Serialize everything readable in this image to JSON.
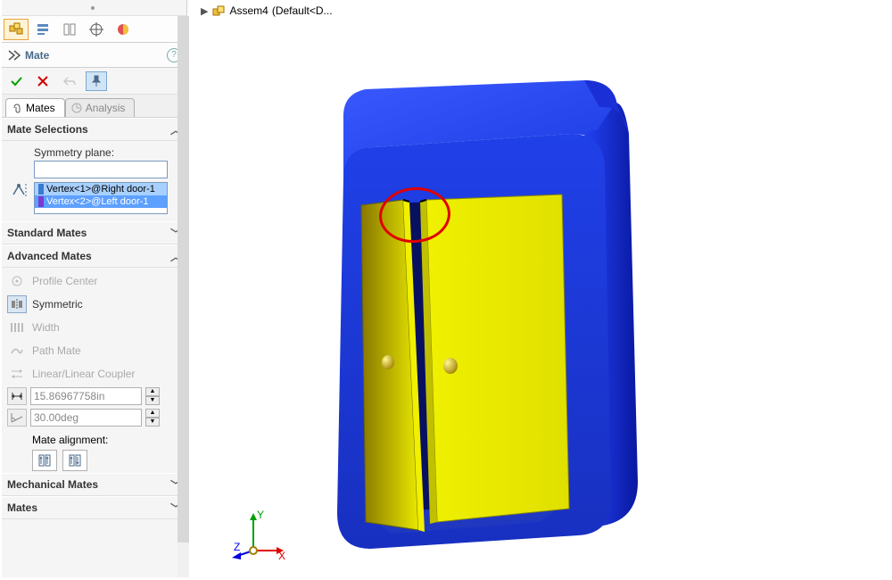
{
  "breadcrumb": {
    "assembly": "Assem4",
    "config": "(Default<D..."
  },
  "panel": {
    "title": "Mate",
    "tabs": {
      "mates": "Mates",
      "analysis": "Analysis"
    },
    "mate_selections": {
      "heading": "Mate Selections",
      "symmetry_plane_label": "Symmetry plane:",
      "symmetry_plane_value": "",
      "entities": [
        "Vertex<1>@Right door-1",
        "Vertex<2>@Left door-1"
      ]
    },
    "standard_mates": {
      "heading": "Standard Mates"
    },
    "advanced_mates": {
      "heading": "Advanced Mates",
      "options": {
        "profile_center": "Profile Center",
        "symmetric": "Symmetric",
        "width": "Width",
        "path_mate": "Path Mate",
        "linear_coupler": "Linear/Linear Coupler"
      },
      "distance_value": "15.86967758in",
      "angle_value": "30.00deg",
      "alignment_label": "Mate alignment:"
    },
    "mechanical_mates": {
      "heading": "Mechanical Mates"
    },
    "mates_section": {
      "heading": "Mates"
    }
  }
}
